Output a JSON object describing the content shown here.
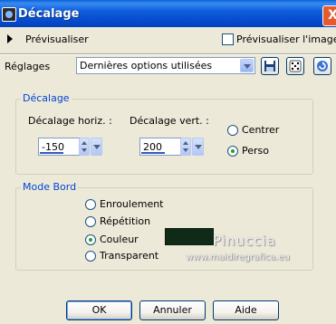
{
  "window": {
    "title": "Décalage",
    "close_glyph": "X"
  },
  "preview": {
    "label": "Prévisualiser",
    "preview_image_label": "Prévisualiser l'image",
    "preview_image_checked": false
  },
  "presets": {
    "label": "Réglages",
    "selected": "Dernières options utilisées"
  },
  "offset": {
    "group_title": "Décalage",
    "horiz_label": "Décalage horiz. :",
    "horiz_value": "-150",
    "vert_label": "Décalage vert. :",
    "vert_value": "200",
    "options": [
      {
        "label": "Centrer",
        "selected": false
      },
      {
        "label": "Perso",
        "selected": true
      }
    ]
  },
  "edge_mode": {
    "group_title": "Mode Bord",
    "options": [
      {
        "label": "Enroulement",
        "selected": false
      },
      {
        "label": "Répétition",
        "selected": false
      },
      {
        "label": "Couleur",
        "selected": true
      },
      {
        "label": "Transparent",
        "selected": false
      }
    ],
    "color": "#0f2a16"
  },
  "watermark": {
    "line1": "Pinuccia",
    "line2": "www.maidiregrafica.eu"
  },
  "buttons": {
    "ok": "OK",
    "cancel": "Annuler",
    "help": "Aide"
  }
}
